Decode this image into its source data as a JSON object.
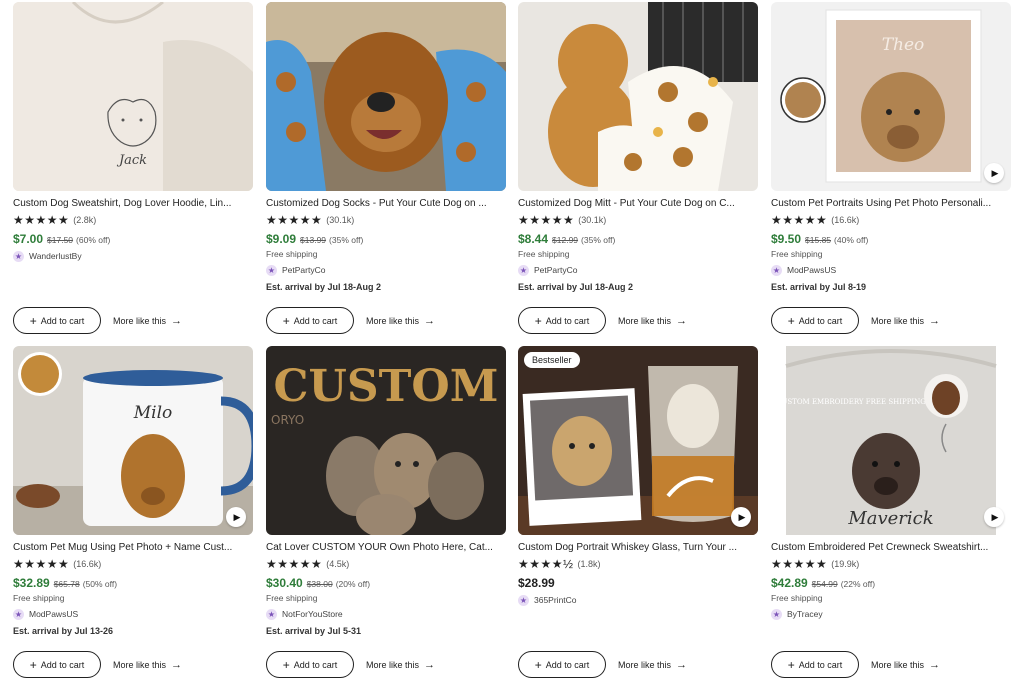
{
  "products": [
    {
      "title": "Custom Dog Sweatshirt, Dog Lover Hoodie, Lin...",
      "stars": "★★★★★",
      "reviews": "(2.8k)",
      "price": "$7.00",
      "original": "$17.50",
      "discount": "(60% off)",
      "shipping": "",
      "shop": "WanderlustBy",
      "eta": "",
      "image_text": "Jack",
      "add_label": "Add to cart",
      "more_label": "More like this"
    },
    {
      "title": "Customized Dog Socks - Put Your Cute Dog on ...",
      "stars": "★★★★★",
      "reviews": "(30.1k)",
      "price": "$9.09",
      "original": "$13.99",
      "discount": "(35% off)",
      "shipping": "Free shipping",
      "shop": "PetPartyCo",
      "eta": "Est. arrival by Jul 18-Aug 2",
      "add_label": "Add to cart",
      "more_label": "More like this"
    },
    {
      "title": "Customized Dog Mitt - Put Your Cute Dog on C...",
      "stars": "★★★★★",
      "reviews": "(30.1k)",
      "price": "$8.44",
      "original": "$12.99",
      "discount": "(35% off)",
      "shipping": "Free shipping",
      "shop": "PetPartyCo",
      "eta": "Est. arrival by Jul 18-Aug 2",
      "add_label": "Add to cart",
      "more_label": "More like this"
    },
    {
      "title": "Custom Pet Portraits Using Pet Photo Personali...",
      "stars": "★★★★★",
      "reviews": "(16.6k)",
      "price": "$9.50",
      "original": "$15.85",
      "discount": "(40% off)",
      "shipping": "Free shipping",
      "shop": "ModPawsUS",
      "eta": "Est. arrival by Jul 8-19",
      "image_text": "Theo",
      "add_label": "Add to cart",
      "more_label": "More like this"
    },
    {
      "title": "Custom Pet Mug Using Pet Photo + Name Cust...",
      "stars": "★★★★★",
      "reviews": "(16.6k)",
      "price": "$32.89",
      "original": "$65.78",
      "discount": "(50% off)",
      "shipping": "Free shipping",
      "shop": "ModPawsUS",
      "eta": "Est. arrival by Jul 13-26",
      "image_text": "Milo",
      "add_label": "Add to cart",
      "more_label": "More like this"
    },
    {
      "title": "Cat Lover CUSTOM YOUR Own Photo Here, Cat...",
      "stars": "★★★★★",
      "reviews": "(4.5k)",
      "price": "$30.40",
      "original": "$38.00",
      "discount": "(20% off)",
      "shipping": "Free shipping",
      "shop": "NotForYouStore",
      "eta": "Est. arrival by Jul 5-31",
      "image_text": "CUSTOM",
      "add_label": "Add to cart",
      "more_label": "More like this"
    },
    {
      "title": "Custom Dog Portrait Whiskey Glass, Turn Your ...",
      "stars": "★★★★½",
      "reviews": "(1.8k)",
      "price": "$28.99",
      "original": "",
      "discount": "",
      "shipping": "",
      "shop": "365PrintCo",
      "eta": "",
      "badge": "Bestseller",
      "add_label": "Add to cart",
      "more_label": "More like this"
    },
    {
      "title": "Custom Embroidered Pet Crewneck Sweatshirt...",
      "stars": "★★★★★",
      "reviews": "(19.9k)",
      "price": "$42.89",
      "original": "$54.99",
      "discount": "(22% off)",
      "shipping": "Free shipping",
      "shop": "ByTracey",
      "eta": "",
      "image_text": "Maverick",
      "image_subtext": "CUSTOM EMBROIDERY FREE SHIPPING",
      "add_label": "Add to cart",
      "more_label": "More like this"
    }
  ]
}
